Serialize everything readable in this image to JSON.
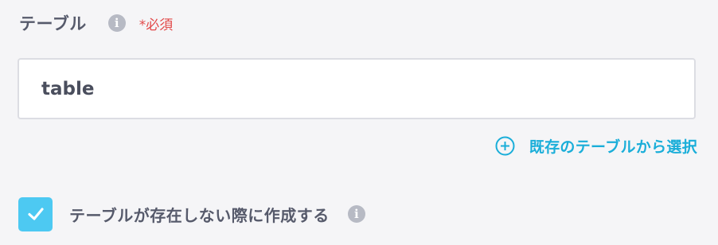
{
  "field": {
    "label": "テーブル",
    "info_icon": "info-icon",
    "required_text": "*必須",
    "input_value": "table",
    "input_placeholder": ""
  },
  "select_existing": {
    "icon": "plus-circle-icon",
    "label": "既存のテーブルから選択"
  },
  "create_option": {
    "checked": true,
    "checkbox_icon": "checkmark-icon",
    "label": "テーブルが存在しない際に作成する",
    "info_icon": "info-icon"
  },
  "colors": {
    "accent": "#1aaed9",
    "checkbox": "#4dc9f2",
    "required": "#e24a4a",
    "info_icon": "#b7bac4"
  }
}
